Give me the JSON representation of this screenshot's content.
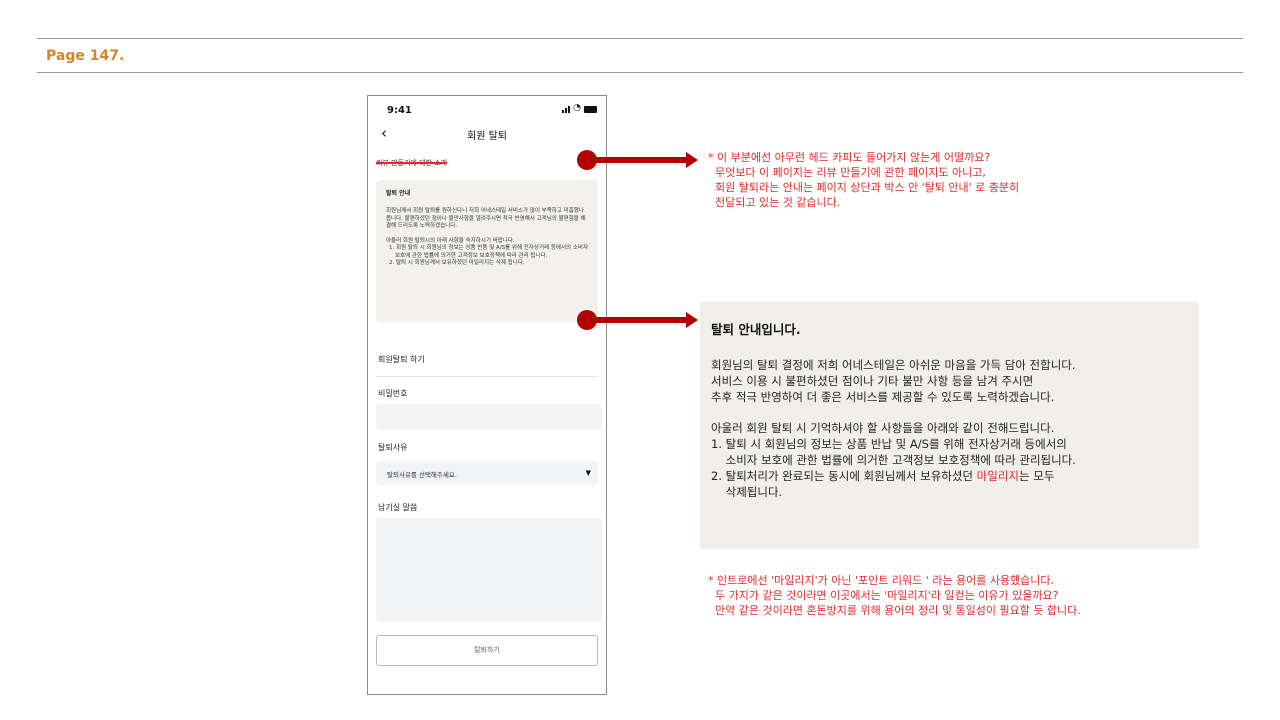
{
  "header": {
    "page_label": "Page 147."
  },
  "phone": {
    "status_time": "9:41",
    "nav_title": "회원 탈퇴",
    "struck_heading": "리뷰 만들기에 대한 소개",
    "notice": {
      "title": "탈퇴 안내",
      "p1": "회원님께서 회원 탈퇴를 원하신다니 저희 어네스테일 서비스가 많이 부족하고 미흡했나 봅니다. 불편하셨던 점이나 불만사항을 알려주시면 적극 반영해서 고객님의 불편함을 해결해 드리도록 노력하겠습니다.",
      "p2": "아울러 회원 탈퇴시의 아래 사항을 숙지하시기 바랍니다.",
      "items": [
        "1. 회원 탈퇴 시 회원님의 정보는 상품 반품 및 A/S를 위해 전자상거래 등에서의 소비자 보호에 관한 법률에 의거한 고객정보 보호정책에 따라 관리 됩니다.",
        "2. 탈퇴 시 회원님께서 보유하셨던 마일리지는 삭제 됩니다."
      ]
    },
    "form": {
      "section_title": "회원탈퇴 하기",
      "password_label": "비밀번호",
      "reason_label": "탈퇴사유",
      "reason_placeholder": "탈퇴사유를 선택해주세요.",
      "message_label": "남기실 말씀",
      "submit_label": "탈퇴하기"
    }
  },
  "comments": {
    "top": "* 이 부분에선 아무런 헤드 카피도 들어가지 않는게 어떨까요?\n  무엇보다 이 페이지는 리뷰 만들기에 관한 페이지도 아니고,\n  회원 탈퇴라는 안내는 페이지 상단과 박스 안 '탈퇴 안내' 로 충분히\n  전달되고 있는 것 같습니다.",
    "bottom": "* 인트로에선 '마일리지'가 아닌 '포인트 리워드 ' 라는 용어를 사용했습니다.\n  두 가지가 같은 것이라면 이곳에서는 '마일리지'라 일컫는 이유가 있을까요?\n  만약 같은 것이라면 혼돈방지를 위해 용어의 정리 및 통일성이 필요할 듯 합니다."
  },
  "panel": {
    "title": "탈퇴 안내입니다.",
    "p1": "회원님의 탈퇴 결정에 저희 어네스테일은 아쉬운 마음을 가득 담아 전합니다.\n서비스 이용 시 불편하셨던 점이나 기타 불만 사항 등을 남겨 주시면\n추후 적극 반영하여 더 좋은 서비스를 제공할 수 있도록 노력하겠습니다.",
    "p2": "아울러 회원 탈퇴 시 기억하셔야 할 사항들을 아래와 같이 전해드립니다.",
    "item1": "1. 탈퇴 시 회원님의 정보는 상품 반납 및 A/S를 위해 전자상거래 등에서의\n    소비자 보호에 관한 법률에 의거한 고객정보 보호정책에 따라 관리됩니다.",
    "item2_pre": "2. 탈퇴처리가 완료되는 동시에 회원님께서 보유하셨던 ",
    "item2_highlight": "마일리지",
    "item2_post": "는 모두\n    삭제됩니다."
  },
  "colors": {
    "accent_orange": "#d3862a",
    "arrow_red": "#b30000",
    "comment_red": "#e02b2b"
  }
}
